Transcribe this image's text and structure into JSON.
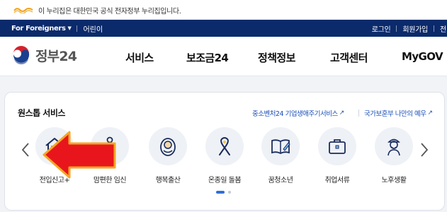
{
  "gov_banner": {
    "text": "이 누리집은 대한민국 공식 전자정부 누리집입니다."
  },
  "util_bar": {
    "foreigners": "For Foreigners",
    "kids": "어린이",
    "login": "로그인",
    "signup": "회원가입",
    "cut_item": "전"
  },
  "logo": {
    "text": "정부24"
  },
  "nav": {
    "items": [
      {
        "label": "서비스"
      },
      {
        "label": "보조금24"
      },
      {
        "label": "정책정보"
      },
      {
        "label": "고객센터"
      },
      {
        "label": "MyGOV"
      }
    ]
  },
  "one_stop": {
    "title": "원스톱 서비스",
    "links": [
      {
        "label": "중소벤처24 기업생애주기서비스"
      },
      {
        "label": "국가보훈부 나만의 예우"
      }
    ],
    "services": [
      {
        "label": "전입신고+",
        "icon": "house-icon"
      },
      {
        "label": "맘편한 임신",
        "icon": "pregnant-person-icon"
      },
      {
        "label": "행복출산",
        "icon": "baby-icon"
      },
      {
        "label": "온종일 돌봄",
        "icon": "ribbon-icon"
      },
      {
        "label": "꿈청소년",
        "icon": "book-pen-icon"
      },
      {
        "label": "취업서류",
        "icon": "briefcase-icon"
      },
      {
        "label": "노후생활",
        "icon": "elder-icon"
      }
    ],
    "pagination": {
      "current": 1,
      "total": 2
    }
  },
  "colors": {
    "navy": "#0b2a6b",
    "accent_blue": "#2f6fd6",
    "link_blue": "#1a4fb8",
    "annotation_red": "#e8161c",
    "annotation_orange": "#f5a623"
  }
}
